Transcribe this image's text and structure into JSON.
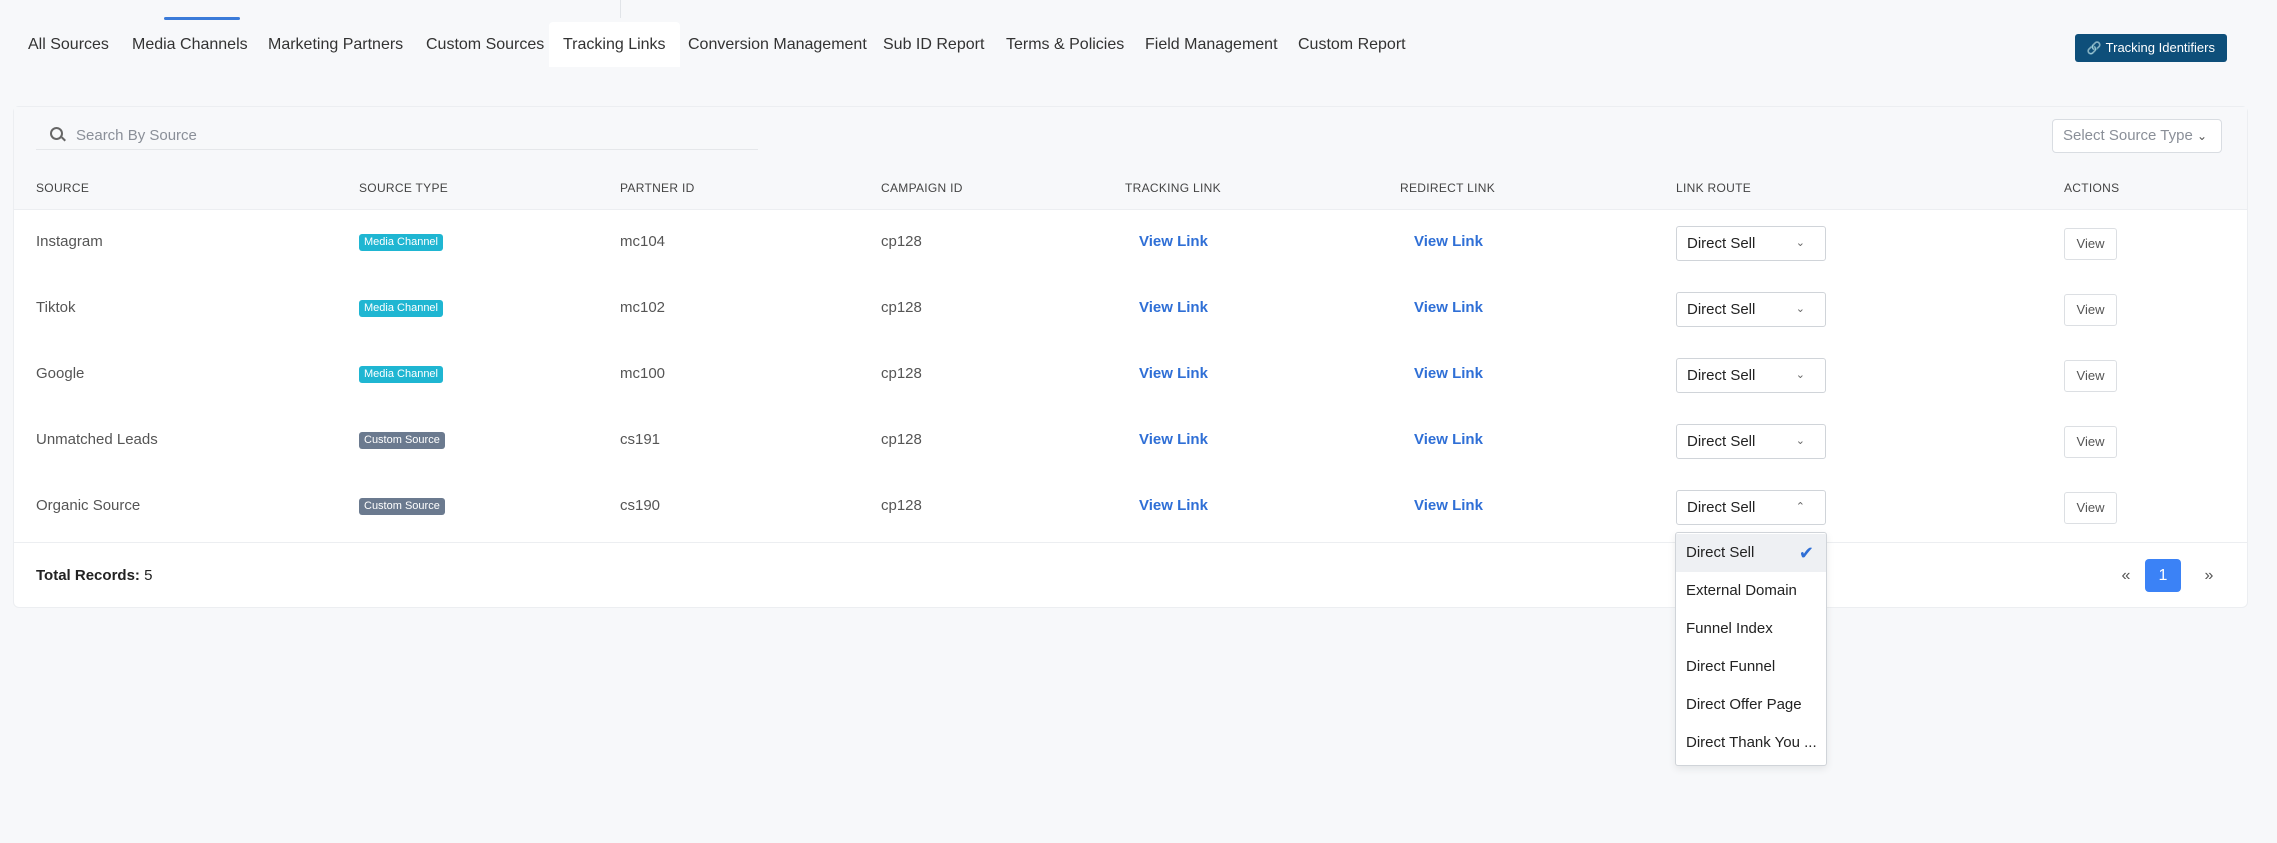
{
  "tabs": [
    {
      "label": "All Sources",
      "active": false
    },
    {
      "label": "Media Channels",
      "active": false
    },
    {
      "label": "Marketing Partners",
      "active": false
    },
    {
      "label": "Custom Sources",
      "active": false
    },
    {
      "label": "Tracking Links",
      "active": true
    },
    {
      "label": "Conversion Management",
      "active": false
    },
    {
      "label": "Sub ID Report",
      "active": false
    },
    {
      "label": "Terms & Policies",
      "active": false
    },
    {
      "label": "Field Management",
      "active": false
    },
    {
      "label": "Custom Report",
      "active": false
    }
  ],
  "tracking_identifiers_button": {
    "label": "Tracking Identifiers",
    "icon": "link-icon",
    "color": "#0e4f7a"
  },
  "search": {
    "placeholder": "Search By Source",
    "value": ""
  },
  "source_type_select": {
    "label": "Select Source Type"
  },
  "columns": [
    "SOURCE",
    "SOURCE TYPE",
    "PARTNER ID",
    "CAMPAIGN ID",
    "TRACKING LINK",
    "REDIRECT LINK",
    "LINK ROUTE",
    "ACTIONS"
  ],
  "rows": [
    {
      "source": "Instagram",
      "type": "Media Channel",
      "type_kind": "media",
      "partner_id": "mc104",
      "campaign_id": "cp128",
      "tracking_link": "View Link",
      "redirect_link": "View Link",
      "route": "Direct Sell",
      "action": "View"
    },
    {
      "source": "Tiktok",
      "type": "Media Channel",
      "type_kind": "media",
      "partner_id": "mc102",
      "campaign_id": "cp128",
      "tracking_link": "View Link",
      "redirect_link": "View Link",
      "route": "Direct Sell",
      "action": "View"
    },
    {
      "source": "Google",
      "type": "Media Channel",
      "type_kind": "media",
      "partner_id": "mc100",
      "campaign_id": "cp128",
      "tracking_link": "View Link",
      "redirect_link": "View Link",
      "route": "Direct Sell",
      "action": "View"
    },
    {
      "source": "Unmatched Leads",
      "type": "Custom Source",
      "type_kind": "custom",
      "partner_id": "cs191",
      "campaign_id": "cp128",
      "tracking_link": "View Link",
      "redirect_link": "View Link",
      "route": "Direct Sell",
      "action": "View"
    },
    {
      "source": "Organic Source",
      "type": "Custom Source",
      "type_kind": "custom",
      "partner_id": "cs190",
      "campaign_id": "cp128",
      "tracking_link": "View Link",
      "redirect_link": "View Link",
      "route": "Direct Sell",
      "action": "View",
      "route_open": true
    }
  ],
  "footer": {
    "total_label": "Total Records:",
    "total_value": "5"
  },
  "pagination": {
    "prev": "«",
    "current": "1",
    "next": "»",
    "active_color": "#3b82f6"
  },
  "route_dropdown": {
    "options": [
      "Direct Sell",
      "External Domain",
      "Funnel Index",
      "Direct Funnel",
      "Direct Offer Page",
      "Direct Thank You ..."
    ],
    "selected": "Direct Sell"
  },
  "colors": {
    "media_badge": "#1fb6d2",
    "custom_badge": "#6b7a8f",
    "link": "#2f6fd6"
  }
}
